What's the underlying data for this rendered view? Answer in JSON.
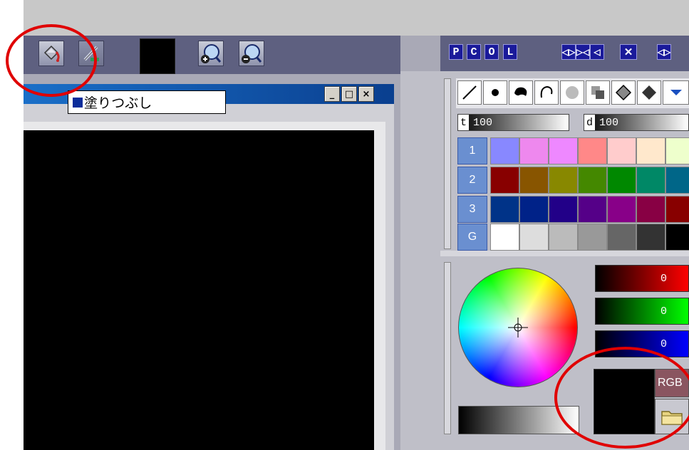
{
  "toolbar": {
    "current_color": "#000000"
  },
  "canvas_window": {
    "minimize_label": "_",
    "maximize_label": "□",
    "close_label": "×"
  },
  "tooltip": {
    "text": "塗りつぶし"
  },
  "palette_toolbar": {
    "tabs": [
      "P",
      "C",
      "O",
      "L"
    ],
    "controls": [
      "◁▷",
      "▷◁",
      "◁",
      "✕",
      "◁▷"
    ]
  },
  "sliders": {
    "transparency_key": "t",
    "transparency_value": "100",
    "density_key": "d",
    "density_value": "100"
  },
  "palette": {
    "rows": [
      {
        "label": "1",
        "colors": [
          "#8888ff",
          "#ee88ee",
          "#ee88ff",
          "#ff8888",
          "#ffcccc",
          "#ffe8cc",
          "#eeffcc"
        ]
      },
      {
        "label": "2",
        "colors": [
          "#880000",
          "#885500",
          "#888800",
          "#448800",
          "#008800",
          "#008866",
          "#006688"
        ]
      },
      {
        "label": "3",
        "colors": [
          "#003388",
          "#002288",
          "#220088",
          "#550088",
          "#880088",
          "#880044",
          "#880000"
        ]
      },
      {
        "label": "G",
        "colors": [
          "#ffffff",
          "#dddddd",
          "#bbbbbb",
          "#999999",
          "#666666",
          "#333333",
          "#000000"
        ]
      }
    ]
  },
  "color_panel": {
    "red_value": "0",
    "green_value": "0",
    "blue_value": "0",
    "rgb_label": "RGB",
    "preview_color": "#000000"
  },
  "accent": {
    "annotation_color": "#e00000",
    "titlebar_color": "#1a6fc8"
  }
}
